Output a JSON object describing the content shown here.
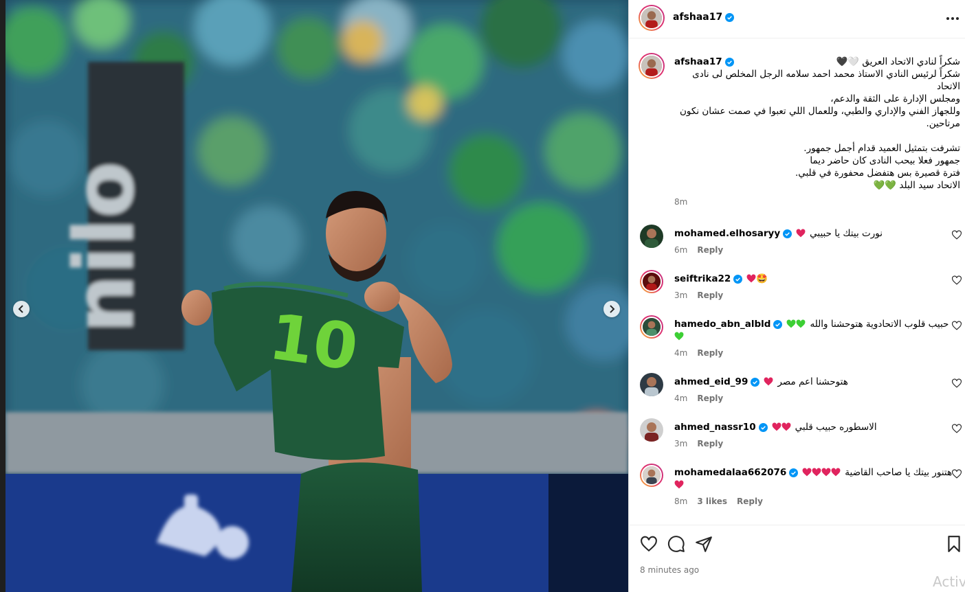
{
  "post": {
    "username": "afshaa17",
    "verified": true
  },
  "media": {
    "jersey_number": "10"
  },
  "caption": {
    "username": "afshaa17",
    "lines": [
      "شكراً لنادي الاتحاد العريق 🤍🖤",
      "شكراً لرئيس النادي الاستاذ محمد احمد سلامه الرجل المخلص لى نادى",
      "الاتحاد",
      "ومجلس الإدارة على الثقة والدعم،",
      "وللجهاز الفني والإداري والطبي، وللعمال اللي تعبوا في صمت عشان نكون",
      "مرتاحين.",
      "",
      "تشرفت بتمثيل العميد قدام أجمل جمهور.",
      "جمهور فعلا بيحب النادى كان حاضر ديما",
      "فترة قصيرة بس هتفضل محفورة في قلبي.",
      "الاتحاد سيد البلد 💚💚"
    ],
    "time": "8m"
  },
  "comments": [
    {
      "username": "mohamed.elhosaryy",
      "text": "نورت بيتك يا حبيبي",
      "hearts": [
        "#e0245e"
      ],
      "time": "6m",
      "reply": "Reply",
      "likes": ""
    },
    {
      "username": "seiftrika22",
      "text": "",
      "hearts": [
        "#e0245e"
      ],
      "extra_emoji": "🤩",
      "time": "3m",
      "reply": "Reply",
      "likes": ""
    },
    {
      "username": "hamedo_abn_albld",
      "text": "حبيب قلوب الاتحادوية هتوحشنا والله",
      "hearts": [
        "#3ccf34",
        "#3ccf34"
      ],
      "wrap_hearts": [
        "#3ccf34"
      ],
      "time": "4m",
      "reply": "Reply",
      "likes": ""
    },
    {
      "username": "ahmed_eid_99",
      "text": "هتوحشنا اعم مصر",
      "hearts": [
        "#e0245e"
      ],
      "time": "4m",
      "reply": "Reply",
      "likes": ""
    },
    {
      "username": "ahmed_nassr10",
      "text": "الاسطوره حبيب قلبي",
      "hearts": [
        "#e0245e",
        "#e0245e"
      ],
      "time": "3m",
      "reply": "Reply",
      "likes": ""
    },
    {
      "username": "mohamedalaa662076",
      "text": "هتنور بيتك يا صاحب القاضية",
      "hearts": [
        "#e0245e",
        "#e0245e",
        "#e0245e",
        "#e0245e"
      ],
      "wrap_hearts": [
        "#e0245e"
      ],
      "time": "8m",
      "reply": "Reply",
      "likes": "3 likes"
    }
  ],
  "footer": {
    "time": "8 minutes ago",
    "watermark": "Activ"
  },
  "colors": {
    "verified": "#0095f6",
    "meta_gray": "#737373",
    "jersey_green": "#1f5a3a",
    "number_green": "#6fd33a"
  },
  "icons": [
    "chevron-left-icon",
    "chevron-right-icon",
    "more-icon",
    "verified-icon",
    "heart-icon",
    "comment-icon",
    "share-icon",
    "bookmark-icon"
  ]
}
